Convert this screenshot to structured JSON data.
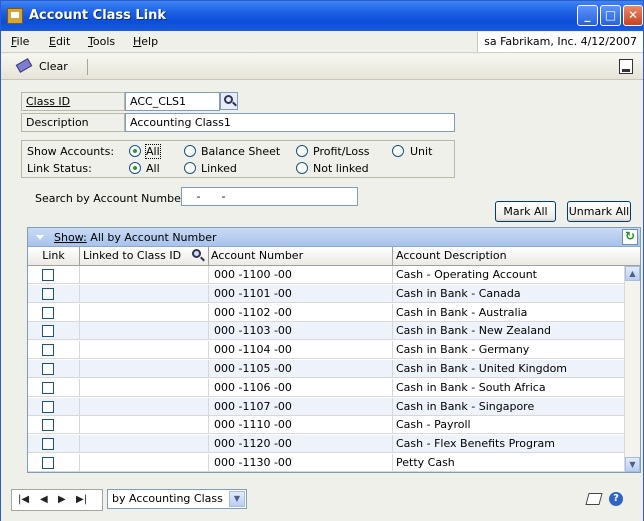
{
  "window": {
    "title": "Account Class Link",
    "user_info": "sa  Fabrikam, Inc.  4/12/2007"
  },
  "menu": [
    {
      "label": "File",
      "key": "F",
      "rest": "ile"
    },
    {
      "label": "Edit",
      "key": "E",
      "rest": "dit"
    },
    {
      "label": "Tools",
      "key": "T",
      "rest": "ools"
    },
    {
      "label": "Help",
      "key": "H",
      "rest": "elp"
    }
  ],
  "toolbar": {
    "clear_label": "Clear"
  },
  "form": {
    "class_id_label": "Class ID",
    "class_id_value": "ACC_CLS1",
    "description_label": "Description",
    "description_value": "Accounting Class1",
    "show_accounts_label": "Show Accounts:",
    "show_accounts_options": [
      "All",
      "Balance Sheet",
      "Profit/Loss",
      "Unit"
    ],
    "show_accounts_selected": "All",
    "link_status_label": "Link Status:",
    "link_status_options": [
      "All",
      "Linked",
      "Not linked"
    ],
    "link_status_selected": "All",
    "search_label": "Search by Account Number",
    "search_value": "   -      -   "
  },
  "buttons": {
    "mark_all": "Mark All",
    "unmark_all": "Unmark All"
  },
  "grid": {
    "show_label": "Show:",
    "show_value": "All by Account Number",
    "columns": [
      "Link",
      "Linked to Class ID",
      "Account Number",
      "Account Description"
    ],
    "rows": [
      {
        "linked": "",
        "account": "000 -1100 -00",
        "description": "Cash - Operating Account"
      },
      {
        "linked": "",
        "account": "000 -1101 -00",
        "description": "Cash in Bank - Canada"
      },
      {
        "linked": "",
        "account": "000 -1102 -00",
        "description": "Cash in Bank - Australia"
      },
      {
        "linked": "",
        "account": "000 -1103 -00",
        "description": "Cash in Bank - New Zealand"
      },
      {
        "linked": "",
        "account": "000 -1104 -00",
        "description": "Cash in Bank - Germany"
      },
      {
        "linked": "",
        "account": "000 -1105 -00",
        "description": "Cash in Bank - United Kingdom"
      },
      {
        "linked": "",
        "account": "000 -1106 -00",
        "description": "Cash in Bank - South Africa"
      },
      {
        "linked": "",
        "account": "000 -1107 -00",
        "description": "Cash in Bank - Singapore"
      },
      {
        "linked": "",
        "account": "000 -1110 -00",
        "description": "Cash - Payroll"
      },
      {
        "linked": "",
        "account": "000 -1120 -00",
        "description": "Cash - Flex Benefits Program"
      },
      {
        "linked": "",
        "account": "000 -1130 -00",
        "description": "Petty Cash"
      }
    ]
  },
  "statusbar": {
    "sort_value": "by Accounting Class"
  }
}
